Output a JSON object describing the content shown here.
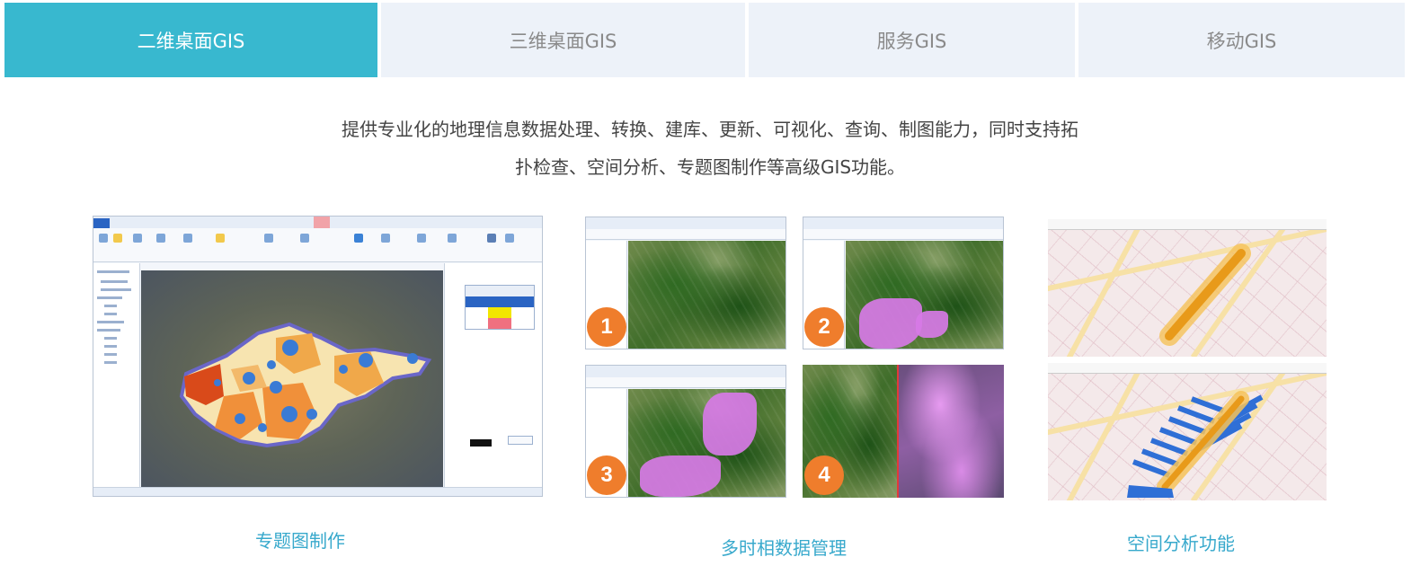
{
  "tabs": [
    {
      "label": "二维桌面GIS",
      "active": true
    },
    {
      "label": "三维桌面GIS",
      "active": false
    },
    {
      "label": "服务GIS",
      "active": false
    },
    {
      "label": "移动GIS",
      "active": false
    }
  ],
  "description": {
    "line1": "提供专业化的地理信息数据处理、转换、建库、更新、可视化、查询、制图能力，同时支持拓",
    "line2": "扑检查、空间分析、专题图制作等高级GIS功能。"
  },
  "features": [
    {
      "caption": "专题图制作"
    },
    {
      "caption": "多时相数据管理",
      "steps": [
        "1",
        "2",
        "3",
        "4"
      ]
    },
    {
      "caption": "空间分析功能"
    }
  ],
  "colors": {
    "accent": "#38b8cf",
    "tab_inactive_bg": "#edf2f9",
    "caption": "#38a9cc",
    "step_badge": "#ef7d2c"
  }
}
